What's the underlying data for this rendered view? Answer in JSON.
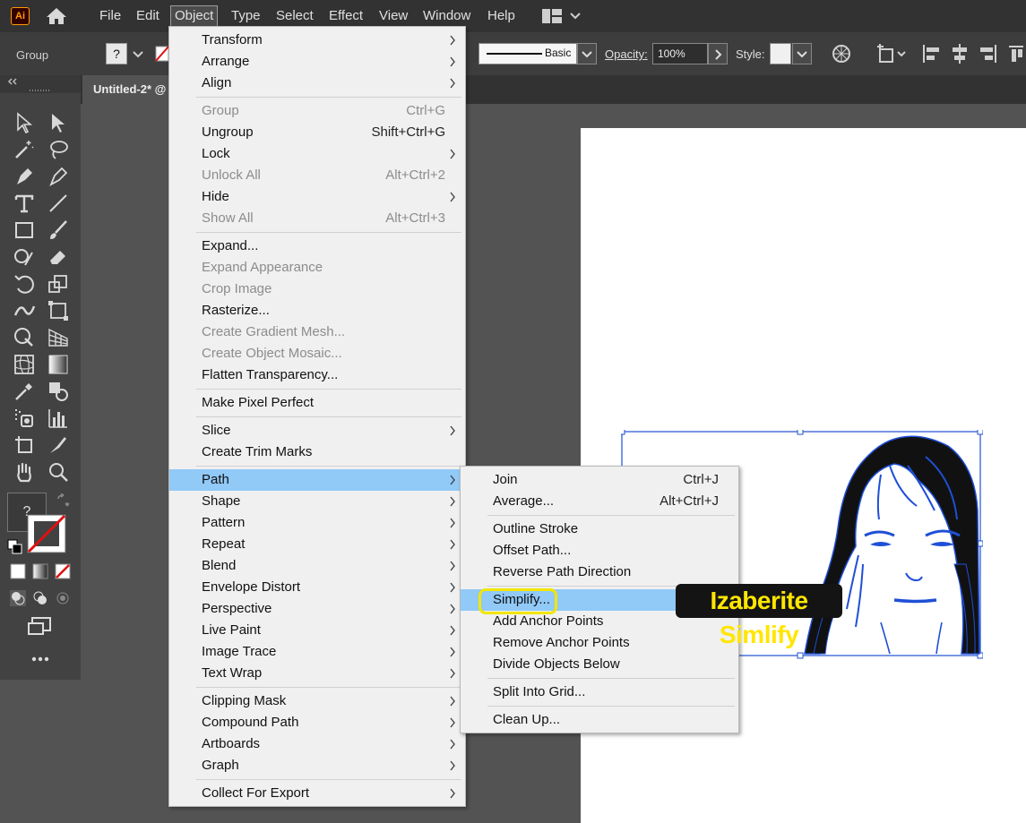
{
  "app": {
    "logo_text": "Ai"
  },
  "menubar": {
    "items": [
      "File",
      "Edit",
      "Object",
      "Type",
      "Select",
      "Effect",
      "View",
      "Window",
      "Help"
    ],
    "active": "Object"
  },
  "controlbar": {
    "selection_label": "Group",
    "stroke_profile": "Basic",
    "opacity_label": "Opacity:",
    "opacity_value": "100%",
    "style_label": "Style:"
  },
  "document": {
    "tab_title": "Untitled-2* @"
  },
  "object_menu": {
    "items": [
      {
        "label": "Transform",
        "submenu": true
      },
      {
        "label": "Arrange",
        "submenu": true
      },
      {
        "label": "Align",
        "submenu": true
      },
      {
        "label": "Group",
        "shortcut": "Ctrl+G",
        "disabled": true
      },
      {
        "label": "Ungroup",
        "shortcut": "Shift+Ctrl+G"
      },
      {
        "label": "Lock",
        "submenu": true
      },
      {
        "label": "Unlock All",
        "shortcut": "Alt+Ctrl+2",
        "disabled": true
      },
      {
        "label": "Hide",
        "submenu": true
      },
      {
        "label": "Show All",
        "shortcut": "Alt+Ctrl+3",
        "disabled": true
      },
      {
        "label": "Expand..."
      },
      {
        "label": "Expand Appearance",
        "disabled": true
      },
      {
        "label": "Crop Image",
        "disabled": true
      },
      {
        "label": "Rasterize..."
      },
      {
        "label": "Create Gradient Mesh...",
        "disabled": true
      },
      {
        "label": "Create Object Mosaic...",
        "disabled": true
      },
      {
        "label": "Flatten Transparency..."
      },
      {
        "label": "Make Pixel Perfect"
      },
      {
        "label": "Slice",
        "submenu": true
      },
      {
        "label": "Create Trim Marks"
      },
      {
        "label": "Path",
        "submenu": true,
        "highlighted": true
      },
      {
        "label": "Shape",
        "submenu": true
      },
      {
        "label": "Pattern",
        "submenu": true
      },
      {
        "label": "Repeat",
        "submenu": true
      },
      {
        "label": "Blend",
        "submenu": true
      },
      {
        "label": "Envelope Distort",
        "submenu": true
      },
      {
        "label": "Perspective",
        "submenu": true
      },
      {
        "label": "Live Paint",
        "submenu": true
      },
      {
        "label": "Image Trace",
        "submenu": true
      },
      {
        "label": "Text Wrap",
        "submenu": true
      },
      {
        "label": "Clipping Mask",
        "submenu": true
      },
      {
        "label": "Compound Path",
        "submenu": true
      },
      {
        "label": "Artboards",
        "submenu": true
      },
      {
        "label": "Graph",
        "submenu": true
      },
      {
        "label": "Collect For Export",
        "submenu": true
      }
    ]
  },
  "path_menu": {
    "items": [
      {
        "label": "Join",
        "shortcut": "Ctrl+J"
      },
      {
        "label": "Average...",
        "shortcut": "Alt+Ctrl+J"
      },
      {
        "label": "Outline Stroke"
      },
      {
        "label": "Offset Path..."
      },
      {
        "label": "Reverse Path Direction"
      },
      {
        "label": "Simplify...",
        "highlighted": true
      },
      {
        "label": "Add Anchor Points"
      },
      {
        "label": "Remove Anchor Points"
      },
      {
        "label": "Divide Objects Below"
      },
      {
        "label": "Split Into Grid..."
      },
      {
        "label": "Clean Up..."
      }
    ]
  },
  "callout": {
    "text": "Izaberite Simlify"
  },
  "colors": {
    "accent": "#91c9f7",
    "callout_text": "#ffe600",
    "selection": "#1f4fd6"
  }
}
